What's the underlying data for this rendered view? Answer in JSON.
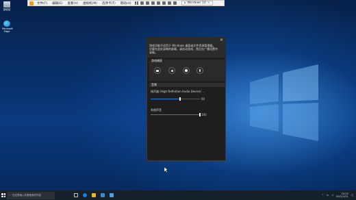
{
  "vm_toolbar": {
    "menus": [
      "文件(F)",
      "编辑(E)",
      "查看(V)",
      "虚拟机(M)",
      "选项卡(T)",
      "帮助(H)"
    ],
    "tab_label": "Windows 10"
  },
  "desktop": {
    "icons": [
      {
        "label": "回收站"
      },
      {
        "label": "Microsoft Edge"
      }
    ]
  },
  "game_bar": {
    "notification": "游戏功能不适用于 Windows 桌面或文件资源管理器。对要在此处录制的屏幕，请启动游戏，然后在广播设置中录制。",
    "capture_title": "游戏捕获",
    "audio_title": "音频",
    "device_label": "扬声器 (High Definition Audio Device)",
    "device_volume": "60",
    "system_label": "系统声音",
    "system_volume": "100",
    "device_volume_fraction": 0.6,
    "system_volume_fraction": 1.0
  },
  "taskbar": {
    "search_placeholder": "在这里输入你要搜索的内容",
    "time": "15:29",
    "date": "2021/1/21"
  }
}
